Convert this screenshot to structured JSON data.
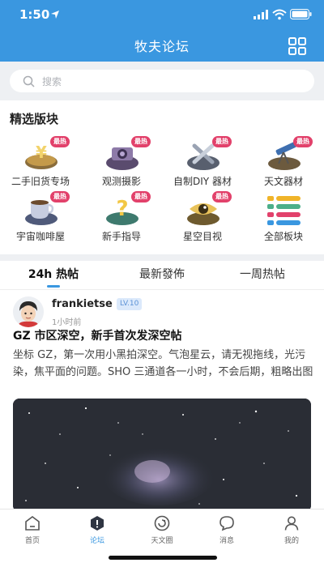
{
  "status_bar": {
    "time": "1:50"
  },
  "header": {
    "title": "牧夫论坛"
  },
  "search": {
    "placeholder": "搜索"
  },
  "featured": {
    "title": "精选版块",
    "hot_badge": "最热",
    "items": [
      {
        "label": "二手旧货专场",
        "icon": "second-hand-icon",
        "hot": true
      },
      {
        "label": "观测摄影",
        "icon": "camera-icon",
        "hot": true
      },
      {
        "label": "自制DIY 器材",
        "icon": "tools-icon",
        "hot": true
      },
      {
        "label": "天文器材",
        "icon": "telescope-icon",
        "hot": true
      },
      {
        "label": "宇宙咖啡屋",
        "icon": "coffee-icon",
        "hot": true
      },
      {
        "label": "新手指导",
        "icon": "question-icon",
        "hot": true
      },
      {
        "label": "星空目视",
        "icon": "eye-icon",
        "hot": true
      },
      {
        "label": "全部板块",
        "icon": "all-sections-icon",
        "hot": false
      }
    ]
  },
  "tabs": [
    {
      "label": "24h 热帖",
      "active": true
    },
    {
      "label": "最新發佈",
      "active": false
    },
    {
      "label": "一周热帖",
      "active": false
    }
  ],
  "post": {
    "username": "frankietse",
    "level": "LV.10",
    "time": "1小时前",
    "title": "GZ 市区深空，新手首次发深空帖",
    "body": "坐标 GZ，第一次用小黑拍深空。气泡星云，请无视拖线，光污染，焦平面的问题。SHO 三通道各一小时，不会后期，粗略出图"
  },
  "bottom_nav": [
    {
      "label": "首页",
      "icon": "home-icon",
      "active": false
    },
    {
      "label": "论坛",
      "icon": "forum-icon",
      "active": true
    },
    {
      "label": "天文圈",
      "icon": "astro-circle-icon",
      "active": false
    },
    {
      "label": "消息",
      "icon": "message-icon",
      "active": false
    },
    {
      "label": "我的",
      "icon": "profile-icon",
      "active": false
    }
  ],
  "colors": {
    "primary": "#3a97e0",
    "hot_badge": "#e2416b",
    "level_badge_bg": "#dbe9fb"
  }
}
